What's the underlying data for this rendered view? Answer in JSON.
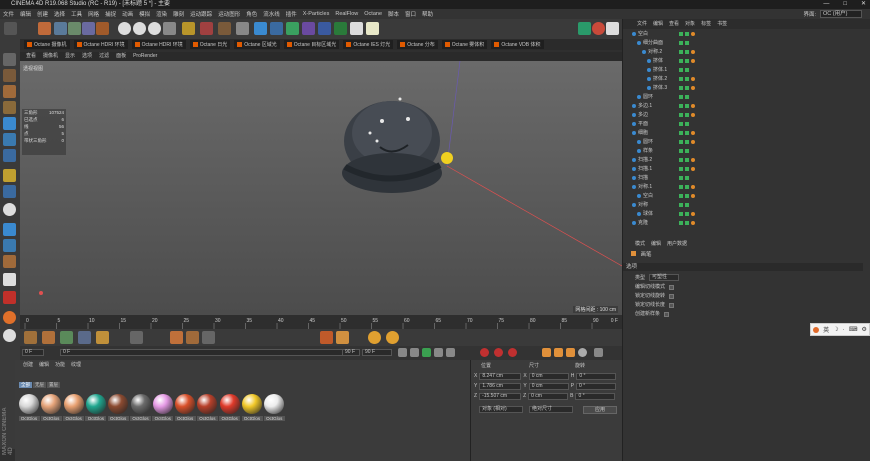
{
  "title_bar": {
    "title": "CINEMA 4D R19.068 Studio (RC - R19) - [未标题 5 *] - 主要",
    "win_buttons": [
      "—",
      "□",
      "✕"
    ]
  },
  "menu": {
    "items": [
      "文件",
      "编辑",
      "创建",
      "选择",
      "工具",
      "网格",
      "捕捉",
      "动画",
      "模拟",
      "渲染",
      "雕刻",
      "运动跟踪",
      "运动图形",
      "角色",
      "流水线",
      "插件",
      "X-Particles",
      "RealFlow",
      "Octane",
      "脚本",
      "窗口",
      "帮助"
    ],
    "layout_label": "界面:",
    "layout_value": "OC (用户)"
  },
  "octane_bar": [
    "Octane 摄像机",
    "Octane HDRI 环境",
    "Octane HDRI 环境",
    "Octane 日光",
    "Octane 区域光",
    "Octane 目标区域光",
    "Octane IES 灯光",
    "Octane 分布",
    "Octane 雾体积",
    "Octane VDB 体积"
  ],
  "viewport": {
    "menu": [
      "查看",
      "摄像机",
      "显示",
      "选项",
      "过滤",
      "面板",
      "ProRender"
    ],
    "label": "透视视图",
    "stats": [
      "三角形",
      "107524",
      "已选点",
      "6",
      "线",
      "56",
      "点",
      "5",
      "带状三角形",
      "0"
    ],
    "grid": "网格间距 : 100 cm"
  },
  "timeline": {
    "ticks": [
      "0",
      "5",
      "10",
      "15",
      "20",
      "25",
      "30",
      "35",
      "40",
      "45",
      "50",
      "55",
      "60",
      "65",
      "70",
      "75",
      "80",
      "85",
      "90"
    ],
    "end": "0 F"
  },
  "playbar": {
    "start": "0 F",
    "current": "0 F",
    "end_a": "90 F",
    "end_b": "90 F"
  },
  "materials": {
    "menu": [
      "创建",
      "编辑",
      "功能",
      "纹理"
    ],
    "filters": [
      "全部",
      "无层",
      "置层"
    ],
    "items": [
      {
        "label": "OctGlos",
        "color": "#d8d8d8"
      },
      {
        "label": "OctGlos",
        "color": "#e6a47a"
      },
      {
        "label": "OctGlos",
        "color": "#e8a070"
      },
      {
        "label": "OctGlos",
        "color": "#1fa78f"
      },
      {
        "label": "OctGlos",
        "color": "#8b4a30"
      },
      {
        "label": "OctGlos",
        "color": "#6b6b6b"
      },
      {
        "label": "OctGlos",
        "color": "#e59ae5"
      },
      {
        "label": "OctGlos",
        "color": "#d9502a"
      },
      {
        "label": "OctGlos",
        "color": "#b8402a"
      },
      {
        "label": "OctGlos",
        "color": "#e03a2a"
      },
      {
        "label": "OctGlos",
        "color": "#f1c828"
      },
      {
        "label": "OctGlos",
        "color": "#ececec"
      }
    ]
  },
  "coords": {
    "headers": [
      "位置",
      "尺寸",
      "旋转"
    ],
    "rows": [
      {
        "axis": "X",
        "pos": "8.247 cm",
        "size": "0 cm",
        "rot_label": "H",
        "rot": "0 °"
      },
      {
        "axis": "Y",
        "pos": "1.786 cm",
        "size": "0 cm",
        "rot_label": "P",
        "rot": "0 °"
      },
      {
        "axis": "Z",
        "pos": "-15.507 cm",
        "size": "0 cm",
        "rot_label": "B",
        "rot": "0 °"
      }
    ],
    "mode_a": "对象 (相对)",
    "mode_b": "绝对尺寸",
    "apply": "应用"
  },
  "object_manager": {
    "tabs": [
      "文件",
      "编辑",
      "查看",
      "对象",
      "标签",
      "书签"
    ],
    "rows": [
      {
        "name": "空白",
        "indent": 0
      },
      {
        "name": "细分曲面",
        "indent": 1
      },
      {
        "name": "对称.2",
        "indent": 2
      },
      {
        "name": "挤体",
        "indent": 3
      },
      {
        "name": "挤体.1",
        "indent": 3
      },
      {
        "name": "挤体.2",
        "indent": 3
      },
      {
        "name": "挤体.3",
        "indent": 3
      },
      {
        "name": "圆环",
        "indent": 1
      },
      {
        "name": "多边.1",
        "indent": 0
      },
      {
        "name": "多边",
        "indent": 0
      },
      {
        "name": "平面",
        "indent": 0
      },
      {
        "name": "细胞",
        "indent": 0
      },
      {
        "name": "圆环",
        "indent": 1
      },
      {
        "name": "样条",
        "indent": 1
      },
      {
        "name": "扫描.2",
        "indent": 0
      },
      {
        "name": "扫描.1",
        "indent": 0
      },
      {
        "name": "扫描",
        "indent": 0
      },
      {
        "name": "对称.1",
        "indent": 0
      },
      {
        "name": "空白",
        "indent": 1
      },
      {
        "name": "对称",
        "indent": 0
      },
      {
        "name": "球体",
        "indent": 1
      },
      {
        "name": "克隆",
        "indent": 0
      }
    ]
  },
  "attributes": {
    "tabs": [
      "模式",
      "编辑",
      "用户数据"
    ],
    "title": "画笔",
    "section": "选项",
    "rows": [
      {
        "label": "类型",
        "value": "可塑性"
      },
      {
        "label": "编辑切线模式",
        "value": ""
      },
      {
        "label": "锁定切线旋转",
        "value": ""
      },
      {
        "label": "锁定切线长度",
        "value": ""
      },
      {
        "label": "创建新样条",
        "value": ""
      }
    ]
  },
  "ime": [
    "英",
    "☽",
    "·",
    "⌨",
    "⚙"
  ],
  "brand": "MAXON CINEMA 4D"
}
